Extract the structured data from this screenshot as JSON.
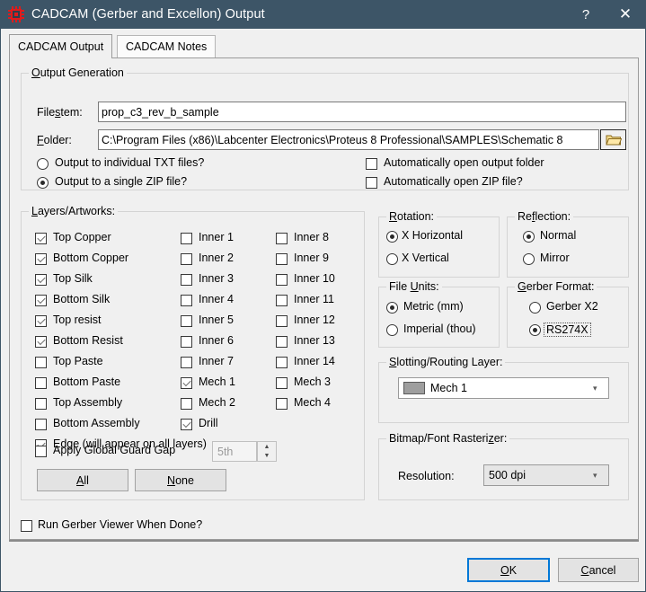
{
  "window": {
    "title": "CADCAM (Gerber and Excellon) Output",
    "icon": "ic-chip-icon",
    "help_label": "?",
    "close_label": "✕",
    "titlebar_color": "#3d5567"
  },
  "tabs": [
    {
      "label": "CADCAM Output",
      "active": true
    },
    {
      "label": "CADCAM Notes",
      "active": false
    }
  ],
  "output_generation": {
    "group_label": "Output Generation",
    "filestem_label": "Filestem:",
    "filestem_value": "prop_c3_rev_b_sample",
    "folder_label": "Folder:",
    "folder_value": "C:\\Program Files (x86)\\Labcenter Electronics\\Proteus 8 Professional\\SAMPLES\\Schematic 8",
    "browse_icon": "folder-icon",
    "radio_txt": "Output to individual TXT files?",
    "radio_txt_checked": false,
    "radio_zip": "Output to a single ZIP file?",
    "radio_zip_checked": true,
    "cb_open_folder": "Automatically open output folder",
    "cb_open_folder_checked": false,
    "cb_open_zip": "Automatically open ZIP file?",
    "cb_open_zip_checked": false
  },
  "layers": {
    "group_label": "Layers/Artworks:",
    "col1": [
      {
        "label": "Top Copper",
        "checked": true
      },
      {
        "label": "Bottom Copper",
        "checked": true
      },
      {
        "label": "Top Silk",
        "checked": true
      },
      {
        "label": "Bottom Silk",
        "checked": true
      },
      {
        "label": "Top resist",
        "checked": true
      },
      {
        "label": "Bottom Resist",
        "checked": true
      },
      {
        "label": "Top Paste",
        "checked": false
      },
      {
        "label": "Bottom Paste",
        "checked": false
      },
      {
        "label": "Top Assembly",
        "checked": false
      },
      {
        "label": "Bottom Assembly",
        "checked": false
      },
      {
        "label": "Edge (will appear on all layers)",
        "checked": true
      }
    ],
    "col2": [
      {
        "label": "Inner 1",
        "checked": false
      },
      {
        "label": "Inner 2",
        "checked": false
      },
      {
        "label": "Inner 3",
        "checked": false
      },
      {
        "label": "Inner 4",
        "checked": false
      },
      {
        "label": "Inner 5",
        "checked": false
      },
      {
        "label": "Inner 6",
        "checked": false
      },
      {
        "label": "Inner 7",
        "checked": false
      },
      {
        "label": "Mech 1",
        "checked": true
      },
      {
        "label": "Mech 2",
        "checked": false
      },
      {
        "label": "Drill",
        "checked": true
      }
    ],
    "col3": [
      {
        "label": "Inner 8",
        "checked": false
      },
      {
        "label": "Inner 9",
        "checked": false
      },
      {
        "label": "Inner 10",
        "checked": false
      },
      {
        "label": "Inner 11",
        "checked": false
      },
      {
        "label": "Inner 12",
        "checked": false
      },
      {
        "label": "Inner 13",
        "checked": false
      },
      {
        "label": "Inner 14",
        "checked": false
      },
      {
        "label": "Mech 3",
        "checked": false
      },
      {
        "label": "Mech 4",
        "checked": false
      }
    ],
    "guard_gap_label": "Apply Global Guard Gap",
    "guard_gap_checked": false,
    "guard_gap_value": "5th",
    "btn_all": "All",
    "btn_none": "None"
  },
  "rotation": {
    "group_label": "Rotation:",
    "options": [
      {
        "label": "X Horizontal",
        "checked": true
      },
      {
        "label": "X Vertical",
        "checked": false
      }
    ]
  },
  "reflection": {
    "group_label": "Reflection:",
    "options": [
      {
        "label": "Normal",
        "checked": true
      },
      {
        "label": "Mirror",
        "checked": false
      }
    ]
  },
  "file_units": {
    "group_label": "File Units:",
    "options": [
      {
        "label": "Metric (mm)",
        "checked": true
      },
      {
        "label": "Imperial (thou)",
        "checked": false
      }
    ]
  },
  "gerber_format": {
    "group_label": "Gerber Format:",
    "options": [
      {
        "label": "Gerber X2",
        "checked": false,
        "focused": false
      },
      {
        "label": "RS274X",
        "checked": true,
        "focused": true
      }
    ]
  },
  "slotting": {
    "group_label": "Slotting/Routing Layer:",
    "value": "Mech 1",
    "swatch_color": "#9e9e9e"
  },
  "rasterizer": {
    "group_label": "Bitmap/Font Rasterizer:",
    "resolution_label": "Resolution:",
    "resolution_value": "500 dpi"
  },
  "footer": {
    "run_viewer_label": "Run Gerber Viewer When Done?",
    "run_viewer_checked": false,
    "ok_label": "OK",
    "cancel_label": "Cancel",
    "focus_color": "#0078d7"
  }
}
